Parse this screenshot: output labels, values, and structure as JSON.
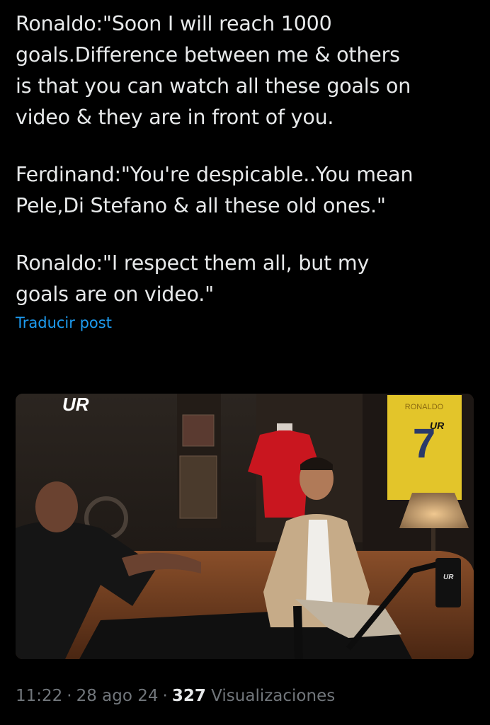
{
  "tweet": {
    "paragraphs": [
      "Ronaldo:\"Soon I will reach 1000\ngoals.Difference between me & others\nis that you can watch all these goals on\nvideo & they are in front of you.",
      "Ferdinand:\"You're despicable..You mean\nPele,Di Stefano & all these old ones.\"",
      "Ronaldo:\"I respect them all, but my\ngoals are on video.\""
    ],
    "translate_label": "Traducir post"
  },
  "media": {
    "watermark": "UR",
    "shirt_name": "RONALDO",
    "shirt_number": "7",
    "shirt_logo": "UR",
    "mic_logo": "UR"
  },
  "meta": {
    "time": "11:22",
    "date": "28 ago 24",
    "views_count": "327",
    "views_label": "Visualizaciones"
  },
  "colors": {
    "link": "#1d9bf0",
    "text": "#e7e9ea",
    "muted": "#71767b",
    "background": "#000000"
  }
}
